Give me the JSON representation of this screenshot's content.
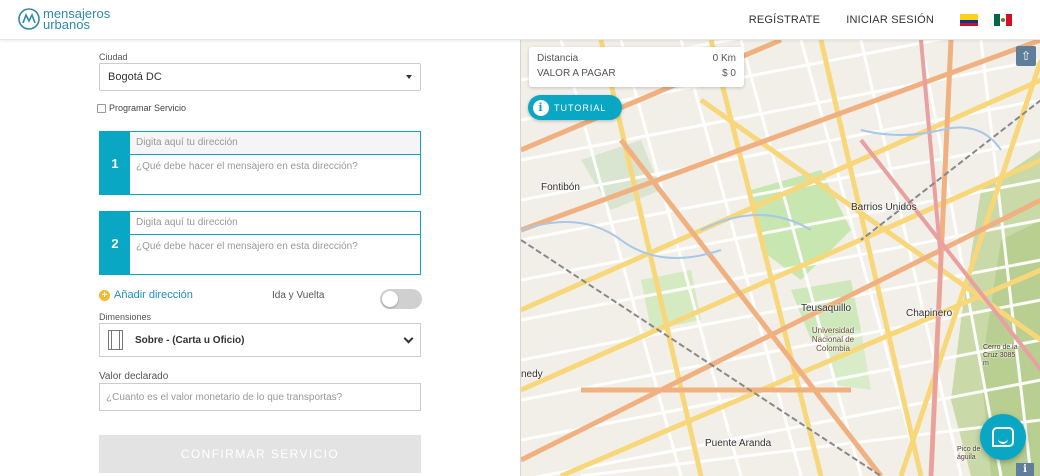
{
  "header": {
    "brand_line1": "mensajeros",
    "brand_line2": "urbanos",
    "register_label": "REGÍSTRATE",
    "login_label": "INICIAR SESIÓN",
    "flags": [
      "colombia-flag-icon",
      "mexico-flag-icon"
    ]
  },
  "form": {
    "city_label": "Ciudad",
    "city_value": "Bogotá DC",
    "schedule_label": "Programar Servicio",
    "addresses": [
      {
        "number": "1",
        "address_placeholder": "Digita aquí tu dirección",
        "task_placeholder": "¿Qué debe hacer el mensajero en esta dirección?"
      },
      {
        "number": "2",
        "address_placeholder": "Digita aquí tu dirección",
        "task_placeholder": "¿Qué debe hacer el mensajero en esta dirección?"
      }
    ],
    "add_address_label": "Añadir dirección",
    "round_trip_label": "Ida y Vuelta",
    "round_trip_on": false,
    "dimensions_label": "Dimensiones",
    "dimensions_value": "Sobre - (Carta u Oficio)",
    "declared_value_label": "Valor declarado",
    "declared_value_placeholder": "¿Cuanto es el valor monetario de lo que transportas?",
    "confirm_label": "CONFIRMAR SERVICIO"
  },
  "map": {
    "distance_label": "Distancia",
    "distance_value": "0 Km",
    "pay_label": "VALOR A PAGAR",
    "pay_value": "$ 0",
    "tutorial_label": "TUTORIAL",
    "places": {
      "fontibon": "Fontibón",
      "barrios_unidos": "Barrios Unidos",
      "teusaquillo": "Teusaquillo",
      "chapinero": "Chapinero",
      "puente_aranda": "Puente Aranda",
      "kennedy": "nedy",
      "universidad": "Universidad Nacional de Colombia",
      "cerro": "Cerro de la Cruz 3085 m",
      "pico": "Pico de águila"
    }
  },
  "colors": {
    "accent": "#0aa7c4",
    "link": "#1f8fbf",
    "disabled_button": "#e3e3e3"
  }
}
